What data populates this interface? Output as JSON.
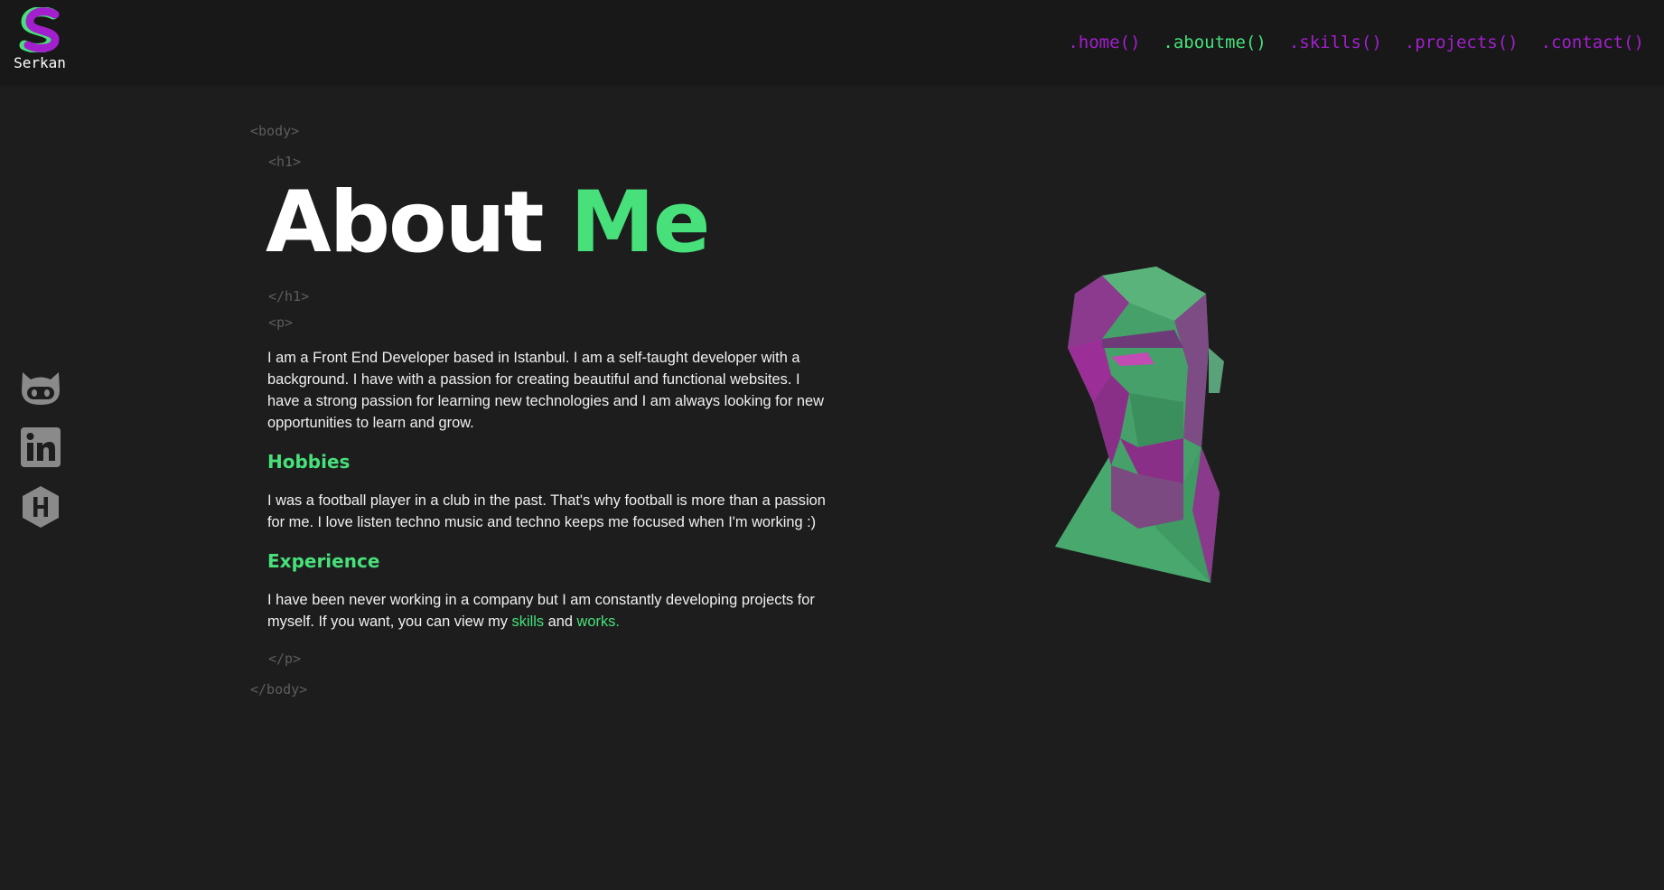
{
  "brand": {
    "name": "Serkan"
  },
  "nav": [
    {
      "label": ".home()",
      "active": false
    },
    {
      "label": ".aboutme()",
      "active": true
    },
    {
      "label": ".skills()",
      "active": false
    },
    {
      "label": ".projects()",
      "active": false
    },
    {
      "label": ".contact()",
      "active": false
    }
  ],
  "social": [
    {
      "icon": "github-icon"
    },
    {
      "icon": "linkedin-icon"
    },
    {
      "icon": "hackerrank-icon"
    }
  ],
  "tags": {
    "body_open": "<body>",
    "h1_open": "<h1>",
    "h1_close": "</h1>",
    "p_open": "<p>",
    "p_close": "</p>",
    "body_close": "</body>"
  },
  "title": {
    "word1": "About",
    "word2": "Me"
  },
  "about": {
    "intro": "I am a Front End Developer based in Istanbul. I am a self-taught developer with a background. I have with a passion for creating beautiful and functional websites. I have a strong passion for learning new technologies and I am always looking for new opportunities to learn and grow.",
    "hobbies_title": "Hobbies",
    "hobbies_text": "I was a football player in a club in the past. That's why football is more than a passion for me. I love listen techno music and techno keeps me focused when I'm working :)",
    "experience_title": "Experience",
    "experience_text_before": "I have been never working in a company but I am constantly developing projects for myself. If you want, you can view my ",
    "skills_link": "skills",
    "and_text": " and ",
    "works_link": "works."
  },
  "colors": {
    "accent_green": "#47e07a",
    "accent_purple": "#a31fce",
    "background": "#1d1d1d",
    "header_bg": "#181818"
  }
}
